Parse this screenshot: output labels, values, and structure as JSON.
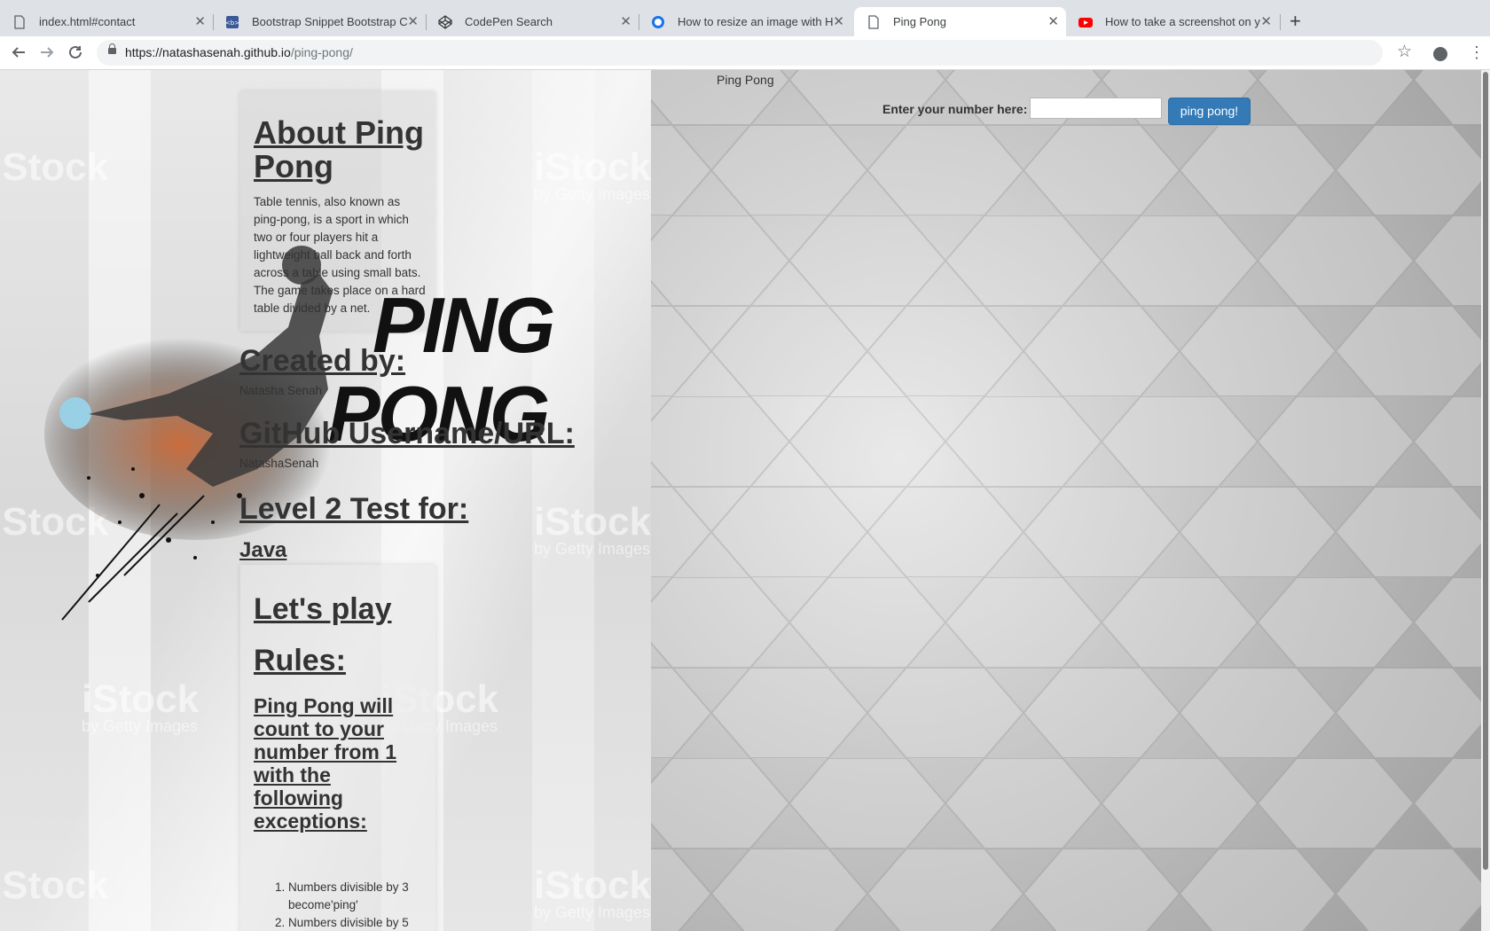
{
  "tabs": [
    {
      "title": "index.html#contact",
      "icon": "file-icon"
    },
    {
      "title": "Bootstrap Snippet Bootstrap C",
      "icon": "bootsnipp-icon"
    },
    {
      "title": "CodePen Search",
      "icon": "codepen-icon"
    },
    {
      "title": "How to resize an image with H",
      "icon": "website-icon"
    },
    {
      "title": "Ping Pong",
      "icon": "file-icon",
      "active": true
    },
    {
      "title": "How to take a screenshot on y",
      "icon": "youtube-icon"
    }
  ],
  "toolbar": {
    "url_host": "https://natashasenah.github.io",
    "url_path": "/ping-pong/"
  },
  "page": {
    "top_title": "Ping Pong",
    "form_label": "Enter your number here:",
    "input_value": "",
    "button_label": "ping pong!",
    "about_heading": "About Ping Pong",
    "about_text": "Table tennis, also known as ping-pong, is a sport in which two or four players hit a lightweight ball back and forth across a table using small bats. The game takes place on a hard table divided by a net.",
    "logo_line1": "PING",
    "logo_line2": "PONG",
    "created_heading": "Created by:",
    "created_name": "Natasha Senah",
    "github_heading": "GitHub Username/URL:",
    "github_name": "NatashaSenah",
    "level_heading": "Level 2 Test for:",
    "java_heading": "Java",
    "play_heading": "Let's play",
    "rules_heading": "Rules:",
    "rules_desc": "Ping Pong will count to your number from 1 with the following exceptions:",
    "rules": [
      "Numbers divisible by 3 become'ping'",
      "Numbers divisible by 5"
    ],
    "watermark_brand": "iStock",
    "watermark_sub": "by Getty Images"
  },
  "colors": {
    "button_bg": "#337ab7",
    "tab_bar": "#dee1e6"
  }
}
